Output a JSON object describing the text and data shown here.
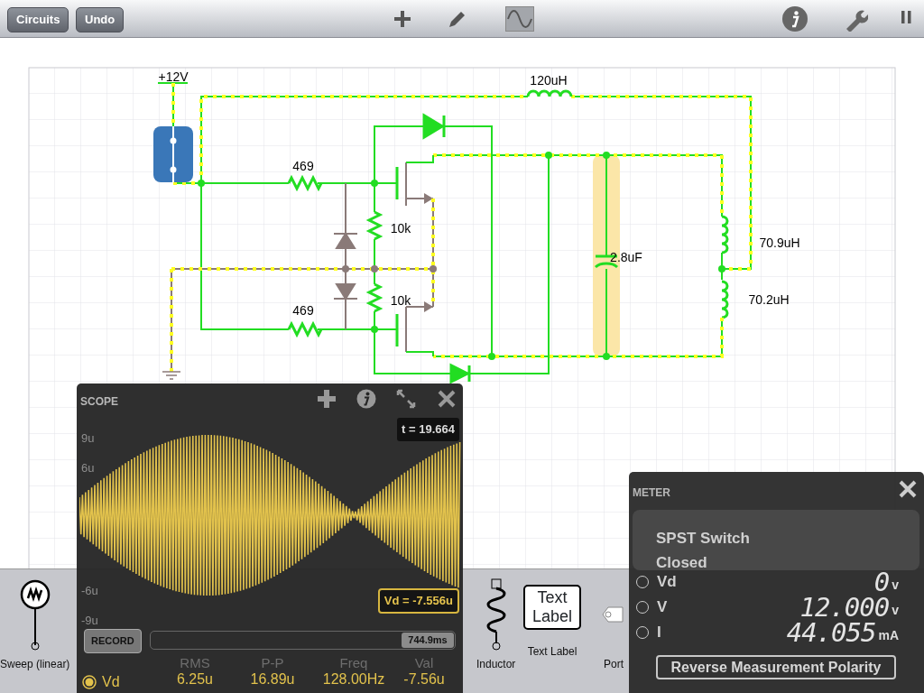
{
  "toolbar": {
    "buttons": [
      "Circuits",
      "Undo"
    ],
    "tools": [
      {
        "kind": "add",
        "selected": false
      },
      {
        "kind": "pencil",
        "selected": false
      },
      {
        "kind": "wave",
        "selected": true
      }
    ]
  },
  "circuit": {
    "labels": [
      "+12V",
      "120uH",
      "469",
      "10k",
      "10k",
      "469",
      "2.8uF",
      "70.9uH",
      "70.2uH"
    ]
  },
  "palette": {
    "items": [
      {
        "kind": "sweep",
        "label": "Sweep (linear)"
      },
      {
        "kind": "inductor",
        "label": "Inductor"
      },
      {
        "kind": "text_label",
        "label": "Text Label",
        "icon_text": "Text Label"
      },
      {
        "kind": "port",
        "label": "Port"
      }
    ]
  },
  "scope": {
    "title": "SCOPE",
    "time": "t = 19.664",
    "y_ticks": [
      "9u",
      "6u",
      "-6u",
      "-9u"
    ],
    "cursor_readout": "Vd = -7.556u",
    "record_button": "RECORD",
    "timeline": {
      "level": 1,
      "value": "744.9ms"
    },
    "channel": {
      "label": "Vd",
      "selected": true
    },
    "stats": [
      {
        "label": "RMS",
        "value": "6.25u"
      },
      {
        "label": "P-P",
        "value": "16.89u"
      },
      {
        "label": "Freq",
        "value": "128.00Hz"
      },
      {
        "label": "Val",
        "value": "-7.56u"
      }
    ]
  },
  "meter": {
    "title": "METER",
    "component": "SPST Switch",
    "state": "Closed",
    "rows": [
      {
        "label": "Vd",
        "selected": false,
        "value": "0",
        "unit": "v"
      },
      {
        "label": "V",
        "selected": false,
        "value": "12.000",
        "unit": "v"
      },
      {
        "label": "I",
        "selected": false,
        "value": "44.055",
        "unit": "mA"
      }
    ],
    "button": "Reverse Measurement Polarity"
  }
}
